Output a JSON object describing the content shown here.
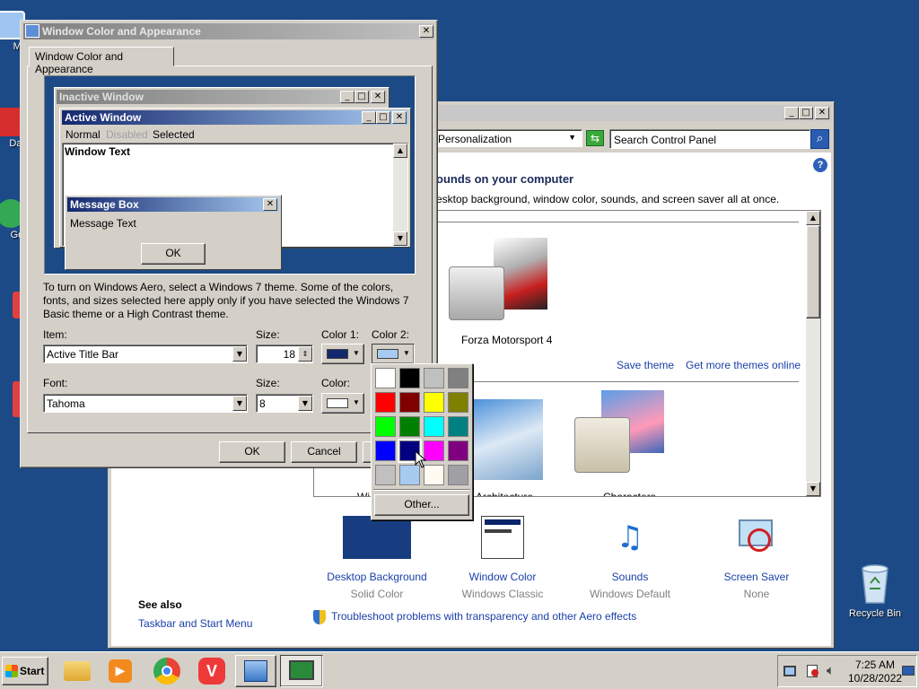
{
  "desktop": {
    "icons": [
      {
        "label": "My"
      },
      {
        "label": "Data"
      },
      {
        "label": "Goo"
      }
    ],
    "recycle_bin": "Recycle Bin"
  },
  "personalization": {
    "breadcrumb": "Personalization",
    "search_placeholder": "Search Control Panel",
    "heading": "ounds on your computer",
    "subtext": "esktop background, window color, sounds, and screen saver all at once.",
    "theme_name": "Forza Motorsport 4",
    "save_theme": "Save theme",
    "get_more_themes": "Get more themes online",
    "bottom_theme_labels": [
      "Wi",
      "Architecture",
      "Characters"
    ],
    "items": [
      {
        "title": "Desktop Background",
        "sub": "Solid Color"
      },
      {
        "title": "Window Color",
        "sub": "Windows Classic"
      },
      {
        "title": "Sounds",
        "sub": "Windows Default"
      },
      {
        "title": "Screen Saver",
        "sub": "None"
      }
    ],
    "see_also": "See also",
    "taskbar_link": "Taskbar and Start Menu",
    "troubleshoot": "Troubleshoot problems with transparency and other Aero effects"
  },
  "dialog": {
    "title": "Window Color and Appearance",
    "tab": "Window Color and Appearance",
    "preview": {
      "inactive_title": "Inactive Window",
      "active_title": "Active Window",
      "menu_normal": "Normal",
      "menu_disabled": "Disabled",
      "menu_selected": "Selected",
      "window_text": "Window Text",
      "msgbox_title": "Message Box",
      "msgbox_text": "Message Text",
      "ok": "OK"
    },
    "info": "To turn on Windows Aero, select a Windows 7 theme.  Some of the colors, fonts, and sizes selected here apply only if you have selected the Windows 7 Basic theme or a High Contrast theme.",
    "item_label": "Item:",
    "item_value": "Active Title Bar",
    "size_label": "Size:",
    "size_value": "18",
    "color1_label": "Color 1:",
    "color2_label": "Color 2:",
    "font_label": "Font:",
    "font_value": "Tahoma",
    "font_size_label": "Size:",
    "font_size_value": "8",
    "color_label": "Color:",
    "ok": "OK",
    "cancel": "Cancel",
    "color1": "#14286e",
    "color2": "#a6caf0"
  },
  "palette": {
    "colors": [
      "#ffffff",
      "#000000",
      "#c0c0c0",
      "#808080",
      "#ff0000",
      "#800000",
      "#ffff00",
      "#808000",
      "#00ff00",
      "#008000",
      "#00ffff",
      "#008080",
      "#0000ff",
      "#000080",
      "#ff00ff",
      "#800080",
      "#c0c0c0",
      "#a6caf0",
      "#fffbf0",
      "#a0a0a4"
    ],
    "other": "Other..."
  },
  "taskbar": {
    "start": "Start",
    "time": "7:25 AM",
    "date": "10/28/2022"
  }
}
